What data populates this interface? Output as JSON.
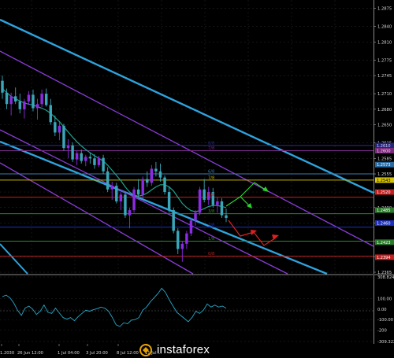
{
  "watermark": "instaforex",
  "chart_data": [
    {
      "type": "candlestick",
      "symbol_note": "",
      "y_range": [
        1.2365,
        1.2885
      ],
      "price_ticks": [
        "1.2875",
        "1.2840",
        "1.2810",
        "1.2775",
        "1.2745",
        "1.2710",
        "1.2680",
        "1.2650",
        "1.2615",
        "1.2585",
        "1.2555",
        "1.2520",
        "1.2490",
        "1.2460",
        "1.2425",
        "1.2395",
        "1.2365"
      ],
      "time_ticks": [
        "1.2030",
        "26 Jun 12:00",
        "1 Jul 04:00",
        "3 Jul 20:00",
        "8 Jul 12:00",
        "11 Jul ..."
      ],
      "grid": true,
      "ohlc": [
        [
          1.2735,
          1.2745,
          1.27,
          1.2712
        ],
        [
          1.2712,
          1.272,
          1.268,
          1.269
        ],
        [
          1.269,
          1.2712,
          1.2668,
          1.2705
        ],
        [
          1.2705,
          1.2722,
          1.269,
          1.2695
        ],
        [
          1.2695,
          1.271,
          1.2672,
          1.268
        ],
        [
          1.268,
          1.27,
          1.2662,
          1.2695
        ],
        [
          1.2695,
          1.2715,
          1.2688,
          1.2708
        ],
        [
          1.2708,
          1.2718,
          1.2676,
          1.2682
        ],
        [
          1.2682,
          1.27,
          1.266,
          1.269
        ],
        [
          1.269,
          1.2718,
          1.2684,
          1.271
        ],
        [
          1.271,
          1.272,
          1.2685,
          1.2688
        ],
        [
          1.2688,
          1.27,
          1.265,
          1.2655
        ],
        [
          1.2655,
          1.2668,
          1.2628,
          1.2635
        ],
        [
          1.2635,
          1.2655,
          1.262,
          1.2648
        ],
        [
          1.2648,
          1.2652,
          1.26,
          1.2605
        ],
        [
          1.2605,
          1.2622,
          1.2585,
          1.261
        ],
        [
          1.261,
          1.2616,
          1.2578,
          1.2583
        ],
        [
          1.2583,
          1.26,
          1.2572,
          1.2595
        ],
        [
          1.2595,
          1.2602,
          1.2575,
          1.258
        ],
        [
          1.258,
          1.2592,
          1.257,
          1.2588
        ],
        [
          1.2588,
          1.2596,
          1.2575,
          1.2585
        ],
        [
          1.2585,
          1.2593,
          1.2565,
          1.2572
        ],
        [
          1.2572,
          1.259,
          1.2568,
          1.2586
        ],
        [
          1.2586,
          1.2592,
          1.2555,
          1.256
        ],
        [
          1.256,
          1.2568,
          1.252,
          1.2525
        ],
        [
          1.2525,
          1.254,
          1.2505,
          1.2532
        ],
        [
          1.2532,
          1.2538,
          1.2498,
          1.2502
        ],
        [
          1.2502,
          1.252,
          1.2485,
          1.2515
        ],
        [
          1.2515,
          1.252,
          1.247,
          1.2475
        ],
        [
          1.2475,
          1.249,
          1.245,
          1.2485
        ],
        [
          1.2485,
          1.253,
          1.248,
          1.2525
        ],
        [
          1.2525,
          1.2545,
          1.251,
          1.2515
        ],
        [
          1.2515,
          1.255,
          1.2508,
          1.2545
        ],
        [
          1.2545,
          1.256,
          1.253,
          1.2538
        ],
        [
          1.2538,
          1.2572,
          1.2532,
          1.2565
        ],
        [
          1.2565,
          1.2578,
          1.255,
          1.256
        ],
        [
          1.256,
          1.2575,
          1.254,
          1.2548
        ],
        [
          1.2548,
          1.2552,
          1.2515,
          1.252
        ],
        [
          1.252,
          1.253,
          1.248,
          1.2485
        ],
        [
          1.2485,
          1.249,
          1.244,
          1.2445
        ],
        [
          1.2445,
          1.245,
          1.24,
          1.241
        ],
        [
          1.241,
          1.2425,
          1.2385,
          1.242
        ],
        [
          1.242,
          1.2445,
          1.241,
          1.244
        ],
        [
          1.244,
          1.247,
          1.2435,
          1.2465
        ],
        [
          1.2465,
          1.2485,
          1.2455,
          1.248
        ],
        [
          1.248,
          1.253,
          1.2475,
          1.2525
        ],
        [
          1.2525,
          1.2545,
          1.25,
          1.2505
        ],
        [
          1.2505,
          1.253,
          1.2495,
          1.252
        ],
        [
          1.252,
          1.2528,
          1.249,
          1.2495
        ],
        [
          1.2495,
          1.251,
          1.248,
          1.2502
        ],
        [
          1.2502,
          1.2508,
          1.247,
          1.2475
        ],
        [
          1.2475,
          1.2488,
          1.2462,
          1.247
        ]
      ],
      "bull_color": "#8b2be2",
      "bear_color": "#3aa6b9",
      "ma_color": "#1fa18c",
      "moving_average": [
        1.272,
        1.2712,
        1.2705,
        1.27,
        1.2696,
        1.2692,
        1.269,
        1.2688,
        1.2685,
        1.2682,
        1.2678,
        1.2672,
        1.2664,
        1.2656,
        1.2646,
        1.2636,
        1.2626,
        1.2617,
        1.2609,
        1.2602,
        1.2596,
        1.259,
        1.2585,
        1.258,
        1.2572,
        1.2562,
        1.2552,
        1.2542,
        1.253,
        1.252,
        1.2514,
        1.2512,
        1.2514,
        1.2518,
        1.2524,
        1.253,
        1.2534,
        1.2534,
        1.253,
        1.2522,
        1.251,
        1.2498,
        1.249,
        1.2484,
        1.2482,
        1.2484,
        1.2488,
        1.2492,
        1.2494,
        1.2494,
        1.2492,
        1.249
      ],
      "murrey_levels": [
        {
          "label": "8/8",
          "price": 1.261,
          "color": "#2a2a9a"
        },
        {
          "label": "7/8",
          "price": 1.26,
          "color": "#7a2a8a"
        },
        {
          "label": "6/8",
          "price": 1.2555,
          "color": "#3a7ab0"
        },
        {
          "label": "7/8",
          "price": 1.2543,
          "color": "#c8b400"
        },
        {
          "label": "4/8",
          "price": 1.251,
          "color": "#c02020"
        },
        {
          "label": "3/8",
          "price": 1.2478,
          "color": "#2a8a2a"
        },
        {
          "label": "2/8",
          "price": 1.2452,
          "color": "#1c2fbd"
        },
        {
          "label": "1/8",
          "price": 1.2425,
          "color": "#2a8a2a"
        },
        {
          "label": "0/8",
          "price": 1.2396,
          "color": "#c02020"
        }
      ],
      "price_tags": [
        {
          "text": "1.2610",
          "price": 1.261,
          "bg": "#23237a",
          "fg": "#d8d8ff"
        },
        {
          "text": "1.2600",
          "price": 1.26,
          "bg": "#7a2a7a",
          "fg": "#ffd8ff"
        },
        {
          "text": "1.2573",
          "price": 1.2573,
          "bg": "#2a6aa0",
          "fg": "#ffffff"
        },
        {
          "text": "1.2543",
          "price": 1.2543,
          "bg": "#d6c400",
          "fg": "#000000"
        },
        {
          "text": "1.2520",
          "price": 1.252,
          "bg": "#c02020",
          "fg": "#ffffff"
        },
        {
          "text": "1.2485",
          "price": 1.2485,
          "bg": "#2a7a2a",
          "fg": "#ffffff"
        },
        {
          "text": "1.2460",
          "price": 1.246,
          "bg": "#1c2fbd",
          "fg": "#ffffff"
        },
        {
          "text": "1.2423",
          "price": 1.2423,
          "bg": "#2a7a2a",
          "fg": "#ffffff"
        },
        {
          "text": "1.2394",
          "price": 1.2394,
          "bg": "#c02020",
          "fg": "#ffffff"
        }
      ]
    },
    {
      "type": "line",
      "name": "",
      "y_range": [
        -309.3225,
        308.8249
      ],
      "y_ticks": [
        "308.8249",
        "100.00",
        "0.00",
        "-100.00",
        "-200",
        "-309.3225"
      ],
      "color": "#26a8c8",
      "values": [
        120,
        135,
        110,
        60,
        -10,
        -60,
        10,
        30,
        0,
        -50,
        -20,
        40,
        -30,
        -40,
        10,
        -35,
        -80,
        -95,
        -80,
        -110,
        -70,
        -40,
        -10,
        -20,
        -5,
        5,
        20,
        10,
        -20,
        -80,
        -150,
        -165,
        -130,
        -140,
        -105,
        -100,
        -80,
        -10,
        20,
        70,
        110,
        150,
        200,
        160,
        90,
        30,
        -30,
        -60,
        -90,
        -120,
        -80,
        -20,
        -40,
        -10,
        50,
        20,
        40,
        20,
        30,
        10
      ]
    }
  ]
}
